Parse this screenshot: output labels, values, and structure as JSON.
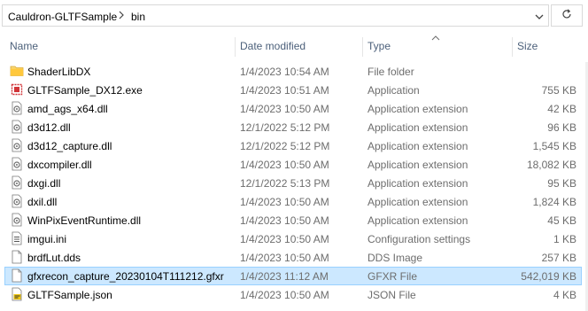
{
  "breadcrumb": {
    "root": "Cauldron-GLTFSample",
    "current": "bin"
  },
  "columns": {
    "name": "Name",
    "date": "Date modified",
    "type": "Type",
    "size": "Size"
  },
  "files": [
    {
      "name": "ShaderLibDX",
      "date": "1/4/2023 10:54 AM",
      "type": "File folder",
      "size": "",
      "icon": "folder-icon"
    },
    {
      "name": "GLTFSample_DX12.exe",
      "date": "1/4/2023 10:51 AM",
      "type": "Application",
      "size": "755 KB",
      "icon": "exe-icon"
    },
    {
      "name": "amd_ags_x64.dll",
      "date": "1/4/2023 10:50 AM",
      "type": "Application extension",
      "size": "42 KB",
      "icon": "dll-icon"
    },
    {
      "name": "d3d12.dll",
      "date": "12/1/2022 5:12 PM",
      "type": "Application extension",
      "size": "96 KB",
      "icon": "dll-icon"
    },
    {
      "name": "d3d12_capture.dll",
      "date": "12/1/2022 5:12 PM",
      "type": "Application extension",
      "size": "1,545 KB",
      "icon": "dll-icon"
    },
    {
      "name": "dxcompiler.dll",
      "date": "1/4/2023 10:50 AM",
      "type": "Application extension",
      "size": "18,082 KB",
      "icon": "dll-icon"
    },
    {
      "name": "dxgi.dll",
      "date": "12/1/2022 5:13 PM",
      "type": "Application extension",
      "size": "95 KB",
      "icon": "dll-icon"
    },
    {
      "name": "dxil.dll",
      "date": "1/4/2023 10:50 AM",
      "type": "Application extension",
      "size": "1,824 KB",
      "icon": "dll-icon"
    },
    {
      "name": "WinPixEventRuntime.dll",
      "date": "1/4/2023 10:50 AM",
      "type": "Application extension",
      "size": "45 KB",
      "icon": "dll-icon"
    },
    {
      "name": "imgui.ini",
      "date": "1/4/2023 10:50 AM",
      "type": "Configuration settings",
      "size": "1 KB",
      "icon": "settings-file-icon"
    },
    {
      "name": "brdfLut.dds",
      "date": "1/4/2023 10:50 AM",
      "type": "DDS Image",
      "size": "257 KB",
      "icon": "generic-file-icon"
    },
    {
      "name": "gfxrecon_capture_20230104T111212.gfxr",
      "date": "1/4/2023 11:12 AM",
      "type": "GFXR File",
      "size": "542,019 KB",
      "icon": "generic-file-icon",
      "selected": true
    },
    {
      "name": "GLTFSample.json",
      "date": "1/4/2023 10:50 AM",
      "type": "JSON File",
      "size": "4 KB",
      "icon": "json-file-icon"
    }
  ]
}
